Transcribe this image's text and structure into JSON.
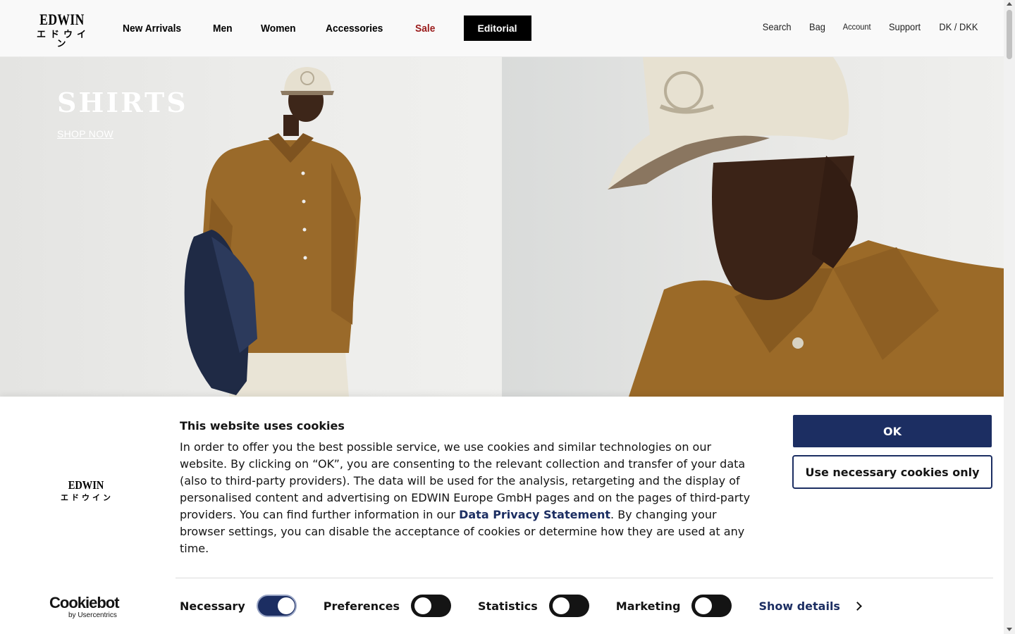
{
  "brand": {
    "name": "EDWIN",
    "name_jp": "エドウイン"
  },
  "nav": {
    "items": [
      {
        "label": "New Arrivals"
      },
      {
        "label": "Men"
      },
      {
        "label": "Women"
      },
      {
        "label": "Accessories"
      },
      {
        "label": "Sale",
        "color": "#9b1c1c"
      },
      {
        "label": "Editorial"
      }
    ]
  },
  "utility": {
    "search": "Search",
    "bag": "Bag",
    "account": "Account",
    "support": "Support",
    "locale": "DK / DKK"
  },
  "hero": {
    "title": "SHIRTS",
    "cta": "SHOP NOW"
  },
  "cookie_banner": {
    "title": "This website uses cookies",
    "text_before_link": "In order to offer you the best possible service, we use cookies and similar technologies on our website. By clicking on “OK”, you are consenting to the relevant collection and transfer of your data (also to third-party providers). The data will be used for the analysis, retargeting and the display of personalised content and advertising on EDWIN Europe GmbH pages and on the pages of third-party providers. You can find further information in our ",
    "link_text": "Data Privacy Statement",
    "text_after_link": ". By changing your browser settings, you can disable the acceptance of cookies or determine how they are used at any time.",
    "ok_button": "OK",
    "necessary_button": "Use necessary cookies only",
    "provider_logo": "Cookiebot",
    "provider_sub": "by Usercentrics",
    "toggles": [
      {
        "label": "Necessary",
        "on": true
      },
      {
        "label": "Preferences",
        "on": false
      },
      {
        "label": "Statistics",
        "on": false
      },
      {
        "label": "Marketing",
        "on": false
      }
    ],
    "show_details": "Show details",
    "accent_color": "#1c2e62"
  }
}
